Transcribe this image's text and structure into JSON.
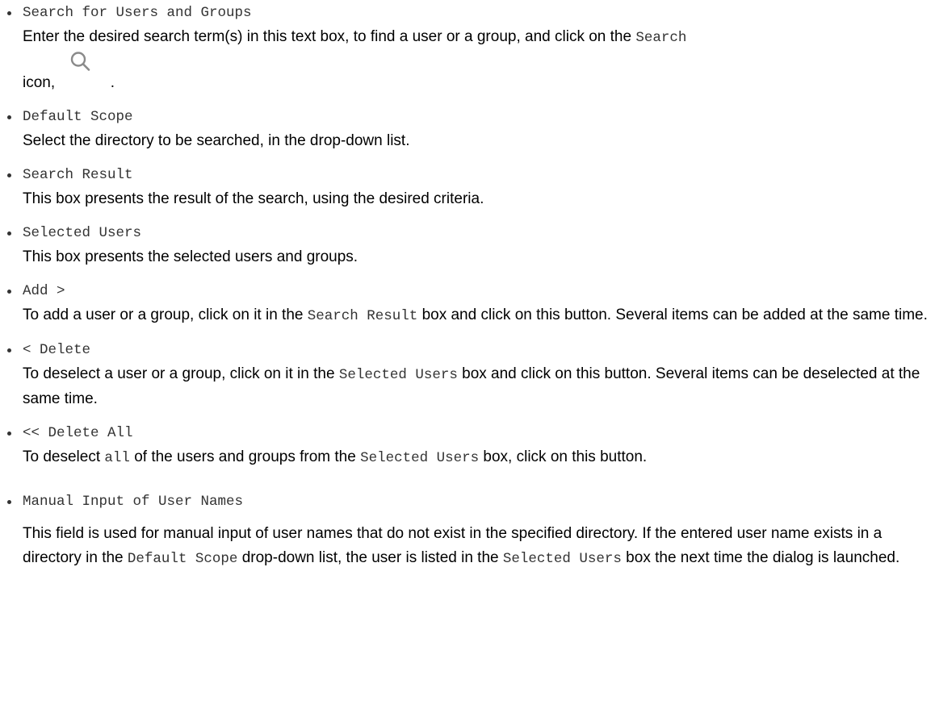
{
  "items": [
    {
      "term": "Search for Users and Groups",
      "desc_text_1": "Enter the desired search term(s) in this text box, to find a user or a group, and click on the ",
      "desc_code_1": "Search",
      "desc_text_2": "icon, ",
      "desc_text_3": " .",
      "icon": "search-icon"
    },
    {
      "term": "Default Scope",
      "desc": "Select the directory to be searched, in the drop-down list."
    },
    {
      "term": "Search Result",
      "desc": "This box presents the result of the search, using the desired criteria."
    },
    {
      "term": "Selected Users",
      "desc": "This box presents the selected users and groups."
    },
    {
      "term": "Add >",
      "desc_text_1": "To add a user or a group, click on it in the ",
      "desc_code_1": "Search Result",
      "desc_text_2": " box and click on this button. Several items can be added at the same time."
    },
    {
      "term": "< Delete",
      "desc_text_1": "To deselect a user or a group, click on it in the ",
      "desc_code_1": "Selected Users",
      "desc_text_2": " box and click on this button. Several items can be deselected at the same time."
    },
    {
      "term": "<< Delete All",
      "desc_text_1": "To deselect ",
      "desc_code_1": "all",
      "desc_text_2": " of the users and groups from the ",
      "desc_code_2": "Selected Users",
      "desc_text_3": " box, click on this button."
    },
    {
      "term": "Manual Input of User Names",
      "desc_text_1": "This field is used for manual input of user names that do not exist in the specified directory. If the entered user name exists in a directory in the ",
      "desc_code_1": "Default Scope",
      "desc_text_2": " drop-down list, the user is listed in the ",
      "desc_code_2": "Selected Users",
      "desc_text_3": " box the next time the dialog is launched."
    }
  ],
  "colors": {
    "text": "#000000",
    "code": "#333333",
    "icon": "#8a8a8a"
  }
}
